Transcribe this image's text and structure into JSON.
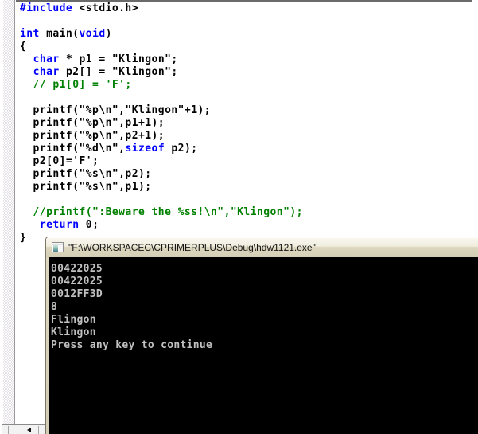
{
  "colors": {
    "keyword": "#0000ff",
    "comment": "#008000",
    "code_text": "#000000",
    "console_bg": "#000000",
    "console_text": "#c0c0c0"
  },
  "editor": {
    "code_lines": [
      [
        [
          "kw",
          "#include"
        ],
        [
          "pl",
          " <stdio.h>"
        ]
      ],
      [],
      [
        [
          "kw",
          "int"
        ],
        [
          "pl",
          " main("
        ],
        [
          "kw",
          "void"
        ],
        [
          "pl",
          ")"
        ]
      ],
      [
        [
          "pl",
          "{"
        ]
      ],
      [
        [
          "pl",
          "  "
        ],
        [
          "kw",
          "char"
        ],
        [
          "pl",
          " * p1 = \"Klingon\";"
        ]
      ],
      [
        [
          "pl",
          "  "
        ],
        [
          "kw",
          "char"
        ],
        [
          "pl",
          " p2[] = \"Klingon\";"
        ]
      ],
      [
        [
          "cm",
          "  // p1[0] = 'F';"
        ]
      ],
      [],
      [
        [
          "pl",
          "  printf(\"%p\\n\",\"Klingon\"+1);"
        ]
      ],
      [
        [
          "pl",
          "  printf(\"%p\\n\",p1+1);"
        ]
      ],
      [
        [
          "pl",
          "  printf(\"%p\\n\",p2+1);"
        ]
      ],
      [
        [
          "pl",
          "  printf(\"%d\\n\","
        ],
        [
          "kw",
          "sizeof"
        ],
        [
          "pl",
          " p2);"
        ]
      ],
      [
        [
          "pl",
          "  p2[0]='F';"
        ]
      ],
      [
        [
          "pl",
          "  printf(\"%s\\n\",p2);"
        ]
      ],
      [
        [
          "pl",
          "  printf(\"%s\\n\",p1);"
        ]
      ],
      [],
      [
        [
          "cm",
          "  //printf(\":Beware the %ss!\\n\",\"Klingon\");"
        ]
      ],
      [
        [
          "pl",
          "   "
        ],
        [
          "kw",
          "return"
        ],
        [
          "pl",
          " 0;"
        ]
      ],
      [
        [
          "pl",
          "}"
        ]
      ]
    ],
    "scrollbar": {
      "left_arrow_icon": "left-triangle"
    }
  },
  "console": {
    "icon": "console-window-icon",
    "title": "\"F:\\WORKSPACEC\\CPRIMERPLUS\\Debug\\hdw1121.exe\"",
    "output_lines": [
      "00422025",
      "00422025",
      "0012FF3D",
      "8",
      "Flingon",
      "Klingon",
      "Press any key to continue"
    ]
  }
}
